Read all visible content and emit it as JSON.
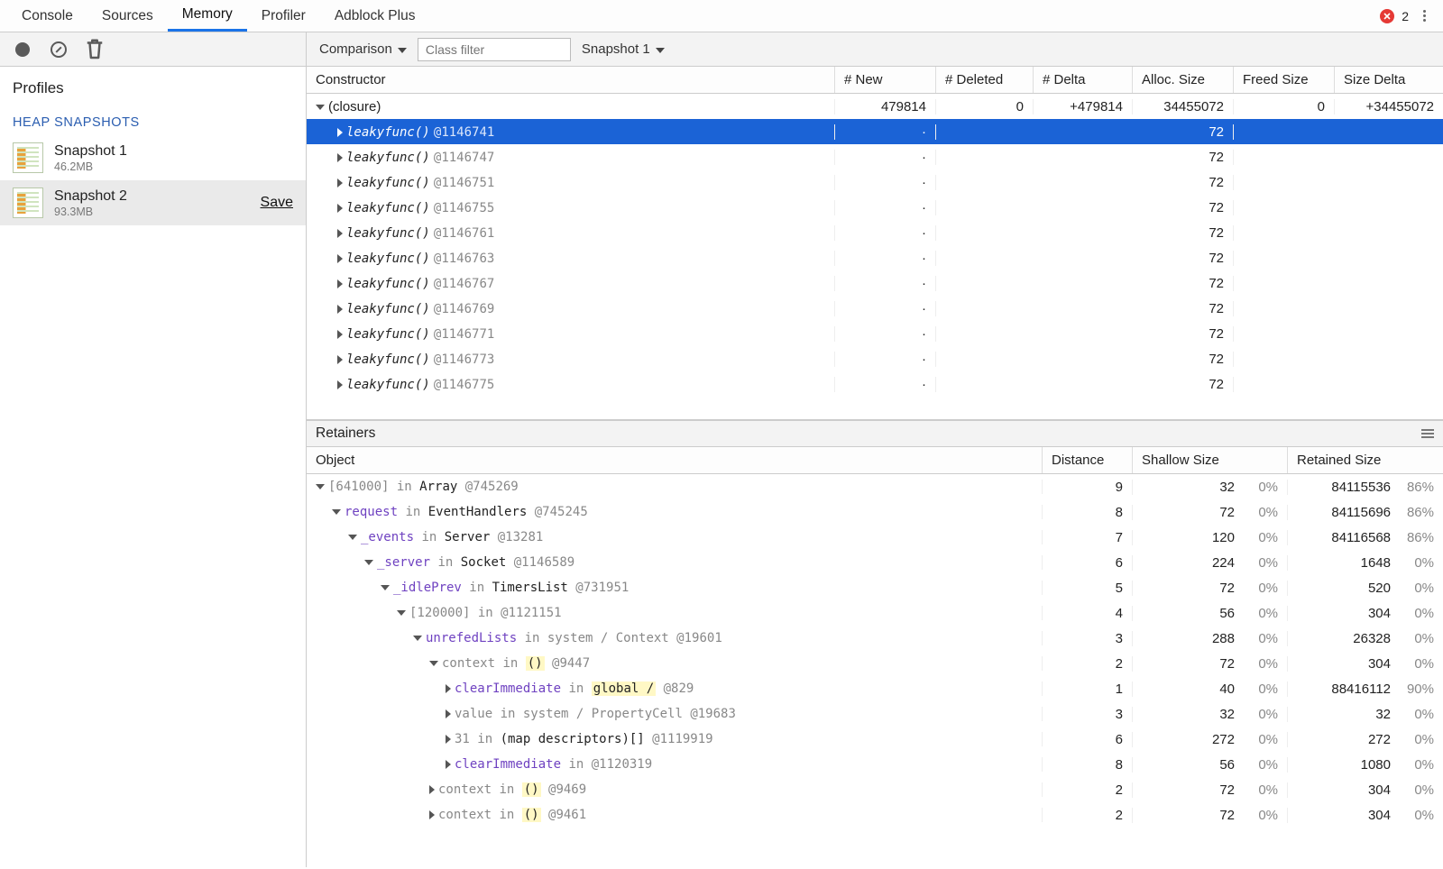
{
  "topTabs": {
    "items": [
      "Console",
      "Sources",
      "Memory",
      "Profiler",
      "Adblock Plus"
    ],
    "activeIndex": 2
  },
  "errors": {
    "count": "2"
  },
  "toolbar": {
    "viewMode": "Comparison",
    "classFilterPlaceholder": "Class filter",
    "baseSnapshot": "Snapshot 1"
  },
  "sidebar": {
    "title": "Profiles",
    "section": "HEAP SNAPSHOTS",
    "saveLabel": "Save",
    "profiles": [
      {
        "name": "Snapshot 1",
        "size": "46.2MB",
        "selected": false
      },
      {
        "name": "Snapshot 2",
        "size": "93.3MB",
        "selected": true
      }
    ]
  },
  "comparison": {
    "columns": [
      "Constructor",
      "# New",
      "# Deleted",
      "# Delta",
      "Alloc. Size",
      "Freed Size",
      "Size Delta"
    ],
    "groupRow": {
      "label": "(closure)",
      "new": "479814",
      "deleted": "0",
      "delta": "+479814",
      "alloc": "34455072",
      "freed": "0",
      "sizeDelta": "+34455072"
    },
    "rows": [
      {
        "fn": "leakyfunc()",
        "id": "@1146741",
        "new": "·",
        "deleted": "",
        "delta": "",
        "alloc": "72",
        "freed": "",
        "sizeDelta": "",
        "selected": true
      },
      {
        "fn": "leakyfunc()",
        "id": "@1146747",
        "new": "·",
        "deleted": "",
        "delta": "",
        "alloc": "72",
        "freed": "",
        "sizeDelta": ""
      },
      {
        "fn": "leakyfunc()",
        "id": "@1146751",
        "new": "·",
        "deleted": "",
        "delta": "",
        "alloc": "72",
        "freed": "",
        "sizeDelta": ""
      },
      {
        "fn": "leakyfunc()",
        "id": "@1146755",
        "new": "·",
        "deleted": "",
        "delta": "",
        "alloc": "72",
        "freed": "",
        "sizeDelta": ""
      },
      {
        "fn": "leakyfunc()",
        "id": "@1146761",
        "new": "·",
        "deleted": "",
        "delta": "",
        "alloc": "72",
        "freed": "",
        "sizeDelta": ""
      },
      {
        "fn": "leakyfunc()",
        "id": "@1146763",
        "new": "·",
        "deleted": "",
        "delta": "",
        "alloc": "72",
        "freed": "",
        "sizeDelta": ""
      },
      {
        "fn": "leakyfunc()",
        "id": "@1146767",
        "new": "·",
        "deleted": "",
        "delta": "",
        "alloc": "72",
        "freed": "",
        "sizeDelta": ""
      },
      {
        "fn": "leakyfunc()",
        "id": "@1146769",
        "new": "·",
        "deleted": "",
        "delta": "",
        "alloc": "72",
        "freed": "",
        "sizeDelta": ""
      },
      {
        "fn": "leakyfunc()",
        "id": "@1146771",
        "new": "·",
        "deleted": "",
        "delta": "",
        "alloc": "72",
        "freed": "",
        "sizeDelta": ""
      },
      {
        "fn": "leakyfunc()",
        "id": "@1146773",
        "new": "·",
        "deleted": "",
        "delta": "",
        "alloc": "72",
        "freed": "",
        "sizeDelta": ""
      },
      {
        "fn": "leakyfunc()",
        "id": "@1146775",
        "new": "·",
        "deleted": "",
        "delta": "",
        "alloc": "72",
        "freed": "",
        "sizeDelta": ""
      }
    ]
  },
  "retainers": {
    "title": "Retainers",
    "columns": [
      "Object",
      "Distance",
      "Shallow Size",
      "Retained Size"
    ],
    "rows": [
      {
        "indent": 0,
        "open": true,
        "segments": [
          {
            "t": "[641000]",
            "c": "obj-grey"
          },
          {
            "t": " in ",
            "c": "in-grey"
          },
          {
            "t": "Array ",
            "c": ""
          },
          {
            "t": "@745269",
            "c": "id-grey"
          }
        ],
        "dist": "9",
        "shal": "32",
        "shalPct": "0%",
        "ret": "84115536",
        "retPct": "86%"
      },
      {
        "indent": 1,
        "open": true,
        "segments": [
          {
            "t": "request",
            "c": "kw-purple"
          },
          {
            "t": " in ",
            "c": "in-grey"
          },
          {
            "t": "EventHandlers ",
            "c": ""
          },
          {
            "t": "@745245",
            "c": "id-grey"
          }
        ],
        "dist": "8",
        "shal": "72",
        "shalPct": "0%",
        "ret": "84115696",
        "retPct": "86%"
      },
      {
        "indent": 2,
        "open": true,
        "segments": [
          {
            "t": "_events",
            "c": "kw-purple"
          },
          {
            "t": " in ",
            "c": "in-grey"
          },
          {
            "t": "Server ",
            "c": ""
          },
          {
            "t": "@13281",
            "c": "id-grey"
          }
        ],
        "dist": "7",
        "shal": "120",
        "shalPct": "0%",
        "ret": "84116568",
        "retPct": "86%"
      },
      {
        "indent": 3,
        "open": true,
        "segments": [
          {
            "t": "_server",
            "c": "kw-purple"
          },
          {
            "t": " in ",
            "c": "in-grey"
          },
          {
            "t": "Socket ",
            "c": ""
          },
          {
            "t": "@1146589",
            "c": "id-grey"
          }
        ],
        "dist": "6",
        "shal": "224",
        "shalPct": "0%",
        "ret": "1648",
        "retPct": "0%"
      },
      {
        "indent": 4,
        "open": true,
        "segments": [
          {
            "t": "_idlePrev",
            "c": "kw-purple"
          },
          {
            "t": " in ",
            "c": "in-grey"
          },
          {
            "t": "TimersList ",
            "c": ""
          },
          {
            "t": "@731951",
            "c": "id-grey"
          }
        ],
        "dist": "5",
        "shal": "72",
        "shalPct": "0%",
        "ret": "520",
        "retPct": "0%"
      },
      {
        "indent": 5,
        "open": true,
        "segments": [
          {
            "t": "[120000]",
            "c": "obj-grey"
          },
          {
            "t": " in ",
            "c": "in-grey"
          },
          {
            "t": "@1121151",
            "c": "id-grey"
          }
        ],
        "dist": "4",
        "shal": "56",
        "shalPct": "0%",
        "ret": "304",
        "retPct": "0%"
      },
      {
        "indent": 6,
        "open": true,
        "segments": [
          {
            "t": "unrefedLists",
            "c": "kw-purple"
          },
          {
            "t": " in ",
            "c": "in-grey"
          },
          {
            "t": "system / Context ",
            "c": "obj-grey"
          },
          {
            "t": "@19601",
            "c": "id-grey"
          }
        ],
        "dist": "3",
        "shal": "288",
        "shalPct": "0%",
        "ret": "26328",
        "retPct": "0%"
      },
      {
        "indent": 7,
        "open": true,
        "segments": [
          {
            "t": "context",
            "c": "obj-grey"
          },
          {
            "t": " in ",
            "c": "in-grey"
          },
          {
            "t": "()",
            "c": "hl"
          },
          {
            "t": " @9447",
            "c": "id-grey"
          }
        ],
        "dist": "2",
        "shal": "72",
        "shalPct": "0%",
        "ret": "304",
        "retPct": "0%"
      },
      {
        "indent": 8,
        "open": false,
        "segments": [
          {
            "t": "clearImmediate",
            "c": "kw-purple"
          },
          {
            "t": " in ",
            "c": "in-grey"
          },
          {
            "t": "global /",
            "c": "hl"
          },
          {
            "t": " @829",
            "c": "id-grey"
          }
        ],
        "dist": "1",
        "shal": "40",
        "shalPct": "0%",
        "ret": "88416112",
        "retPct": "90%"
      },
      {
        "indent": 8,
        "open": false,
        "segments": [
          {
            "t": "value",
            "c": "obj-grey"
          },
          {
            "t": " in ",
            "c": "in-grey"
          },
          {
            "t": "system / PropertyCell ",
            "c": "obj-grey"
          },
          {
            "t": "@19683",
            "c": "id-grey"
          }
        ],
        "dist": "3",
        "shal": "32",
        "shalPct": "0%",
        "ret": "32",
        "retPct": "0%"
      },
      {
        "indent": 8,
        "open": false,
        "segments": [
          {
            "t": "31",
            "c": "obj-grey"
          },
          {
            "t": " in ",
            "c": "in-grey"
          },
          {
            "t": "(map descriptors)[] ",
            "c": ""
          },
          {
            "t": "@1119919",
            "c": "id-grey"
          }
        ],
        "dist": "6",
        "shal": "272",
        "shalPct": "0%",
        "ret": "272",
        "retPct": "0%"
      },
      {
        "indent": 8,
        "open": false,
        "segments": [
          {
            "t": "clearImmediate",
            "c": "kw-purple"
          },
          {
            "t": " in ",
            "c": "in-grey"
          },
          {
            "t": "@1120319",
            "c": "id-grey"
          }
        ],
        "dist": "8",
        "shal": "56",
        "shalPct": "0%",
        "ret": "1080",
        "retPct": "0%"
      },
      {
        "indent": 7,
        "open": false,
        "segments": [
          {
            "t": "context",
            "c": "obj-grey"
          },
          {
            "t": " in ",
            "c": "in-grey"
          },
          {
            "t": "()",
            "c": "hl"
          },
          {
            "t": " @9469",
            "c": "id-grey"
          }
        ],
        "dist": "2",
        "shal": "72",
        "shalPct": "0%",
        "ret": "304",
        "retPct": "0%"
      },
      {
        "indent": 7,
        "open": false,
        "segments": [
          {
            "t": "context",
            "c": "obj-grey"
          },
          {
            "t": " in ",
            "c": "in-grey"
          },
          {
            "t": "()",
            "c": "hl"
          },
          {
            "t": " @9461",
            "c": "id-grey"
          }
        ],
        "dist": "2",
        "shal": "72",
        "shalPct": "0%",
        "ret": "304",
        "retPct": "0%"
      }
    ]
  }
}
